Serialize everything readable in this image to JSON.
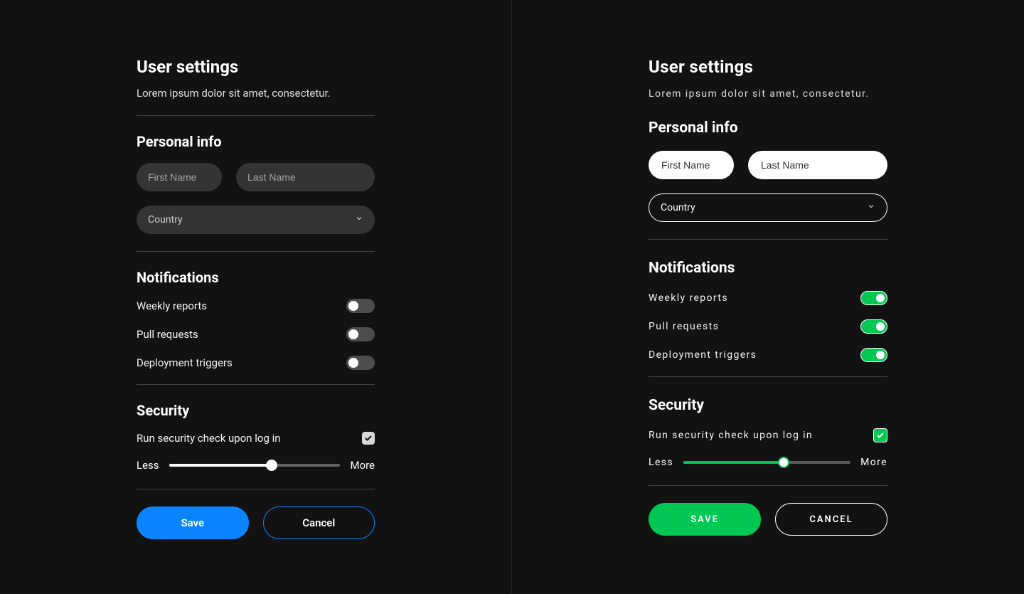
{
  "left": {
    "title": "User settings",
    "subtitle": "Lorem ipsum dolor sit amet, consectetur.",
    "personal": {
      "heading": "Personal info",
      "first_name_placeholder": "First Name",
      "last_name_placeholder": "Last Name",
      "country_label": "Country"
    },
    "notifications": {
      "heading": "Notifications",
      "items": [
        {
          "label": "Weekly reports",
          "on": false
        },
        {
          "label": "Pull requests",
          "on": false
        },
        {
          "label": "Deployment triggers",
          "on": false
        }
      ]
    },
    "security": {
      "heading": "Security",
      "check_label": "Run security check upon log in",
      "checked": true,
      "slider_min_label": "Less",
      "slider_max_label": "More",
      "slider_percent": 60
    },
    "buttons": {
      "save": "Save",
      "cancel": "Cancel"
    },
    "accent_color": "#0a84ff"
  },
  "right": {
    "title": "User settings",
    "subtitle": "Lorem ipsum dolor sit amet, consectetur.",
    "personal": {
      "heading": "Personal info",
      "first_name_placeholder": "First Name",
      "last_name_placeholder": "Last Name",
      "country_label": "Country"
    },
    "notifications": {
      "heading": "Notifications",
      "items": [
        {
          "label": "Weekly reports",
          "on": true
        },
        {
          "label": "Pull requests",
          "on": true
        },
        {
          "label": "Deployment triggers",
          "on": true
        }
      ]
    },
    "security": {
      "heading": "Security",
      "check_label": "Run security check upon log in",
      "checked": true,
      "slider_min_label": "Less",
      "slider_max_label": "More",
      "slider_percent": 60
    },
    "buttons": {
      "save": "SAVE",
      "cancel": "CANCEL"
    },
    "accent_color": "#00c853"
  }
}
